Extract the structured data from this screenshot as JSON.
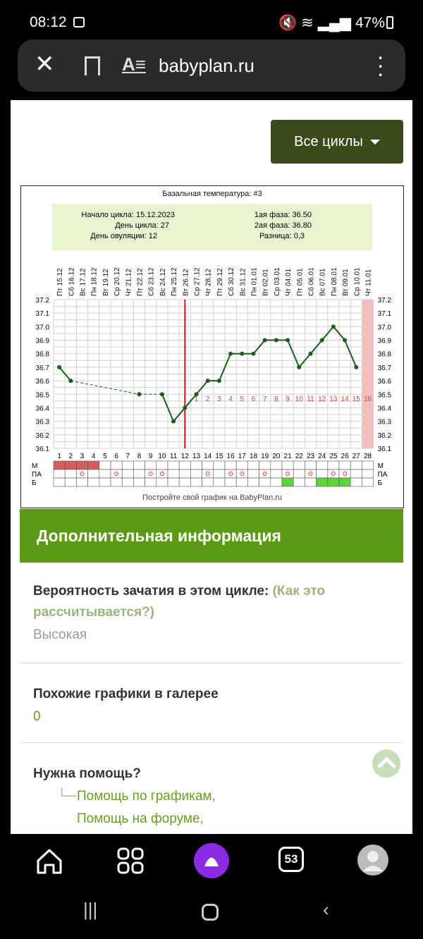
{
  "status": {
    "time": "08:12",
    "battery": "47%"
  },
  "browser": {
    "url": "babyplan.ru",
    "tab_count": "53"
  },
  "page": {
    "cycles_button": "Все циклы",
    "chart_data": {
      "type": "line",
      "title": "Базальная температура: #3",
      "summary": {
        "start": "Начало цикла: 15.12.2023",
        "day": "День цикла: 27",
        "ovulation": "День овуляции: 12",
        "phase1": "1ая фаза: 36.50",
        "phase2": "2ая фаза: 36.80",
        "diff": "Разница: 0,3"
      },
      "dates": [
        "Пт 15.12",
        "Сб 16.12",
        "Вс 17.12",
        "Пн 18.12",
        "Вт 19.12",
        "Ср 20.12",
        "Чт 21.12",
        "Пт 22.12",
        "Сб 23.12",
        "Вс 24.12",
        "Пн 25.12",
        "Вт 26.12",
        "Ср 27.12",
        "Чт 28.12",
        "Пт 29.12",
        "Сб 30.12",
        "Вс 31.12",
        "Пн 01.01",
        "Вт 02.01",
        "Ср 03.01",
        "Чт 04.01",
        "Пт 05.01",
        "Сб 06.01",
        "Вс 07.01",
        "Пн 08.01",
        "Вт 09.01",
        "Ср 10.01",
        "Чт 11.01"
      ],
      "days": [
        "1",
        "2",
        "3",
        "4",
        "5",
        "6",
        "7",
        "8",
        "9",
        "10",
        "11",
        "12",
        "13",
        "14",
        "15",
        "16",
        "17",
        "18",
        "19",
        "20",
        "21",
        "22",
        "23",
        "24",
        "25",
        "26",
        "27",
        "28"
      ],
      "y_ticks": [
        "37.2",
        "37.1",
        "37.0",
        "36.9",
        "36.8",
        "36.7",
        "36.6",
        "36.5",
        "36.4",
        "36.3",
        "36.2",
        "36.1"
      ],
      "ylim": [
        36.1,
        37.2
      ],
      "temperatures": [
        36.7,
        36.6,
        null,
        null,
        null,
        null,
        null,
        36.5,
        null,
        36.5,
        36.3,
        36.4,
        36.5,
        36.6,
        36.6,
        36.8,
        36.8,
        36.8,
        36.9,
        36.9,
        36.9,
        36.7,
        36.8,
        36.9,
        37.0,
        36.9,
        36.7,
        null
      ],
      "phase2_labels": [
        "1",
        "2",
        "3",
        "4",
        "5",
        "6",
        "7",
        "8",
        "9",
        "10",
        "11",
        "12",
        "13",
        "14",
        "15",
        "16"
      ],
      "ovulation_day": 12,
      "row_labels": [
        "М",
        "ПА",
        "Б"
      ],
      "menstruation_days": [
        1,
        2,
        3,
        4
      ],
      "pa_days": [
        3,
        6,
        9,
        10,
        14,
        16,
        17,
        19,
        21,
        23,
        25,
        26
      ],
      "b_days": [
        21,
        24,
        25,
        26
      ],
      "footer": "Постройте свой график на BabyPlan.ru"
    },
    "info_header": "Дополнительная информация",
    "probability": {
      "label": "Вероятность зачатия в этом цикле:",
      "link": "(Как это рассчитывается?)",
      "value": "Высокая"
    },
    "similar": {
      "label": "Похожие графики в галерее",
      "value": "0"
    },
    "help": {
      "label": "Нужна помощь?",
      "links": [
        "Помощь по графикам,",
        "Помощь на форуме,"
      ]
    }
  }
}
